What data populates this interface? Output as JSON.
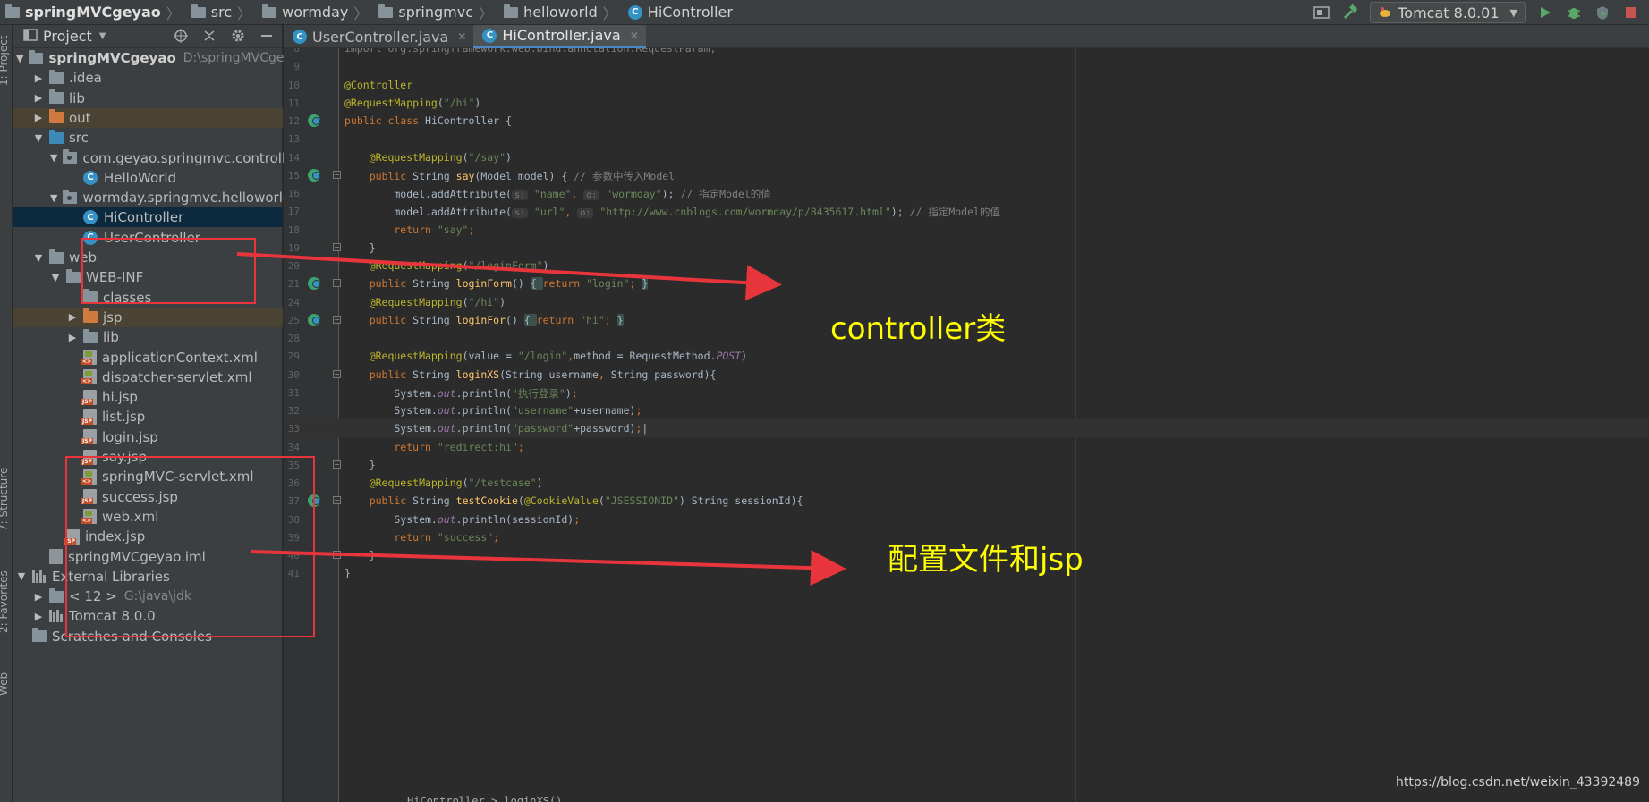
{
  "breadcrumbs": [
    {
      "label": "springMVCgeyao",
      "kind": "folder"
    },
    {
      "label": "src",
      "kind": "folder"
    },
    {
      "label": "wormday",
      "kind": "folder"
    },
    {
      "label": "springmvc",
      "kind": "folder"
    },
    {
      "label": "helloworld",
      "kind": "folder"
    },
    {
      "label": "HiController",
      "kind": "class"
    }
  ],
  "toolbar": {
    "run_config": "Tomcat 8.0.01",
    "icons": [
      "project-structure-icon",
      "build-hammer-icon",
      "run-icon",
      "debug-icon",
      "coverage-icon",
      "stop-icon"
    ]
  },
  "left_stripe": {
    "tabs": [
      "1: Project",
      "7: Structure",
      "2: Favorites",
      "Web"
    ]
  },
  "project_panel": {
    "title": "Project",
    "tree": [
      {
        "label": "springMVCgeyao",
        "extra": "D:\\springMVCgeyao",
        "icon": "module-folder",
        "arrow": "down",
        "depth": 0,
        "bold": true
      },
      {
        "label": ".idea",
        "icon": "folder-grey",
        "arrow": "right",
        "depth": 1
      },
      {
        "label": "lib",
        "icon": "folder-grey",
        "arrow": "right",
        "depth": 1
      },
      {
        "label": "out",
        "icon": "folder-orange",
        "arrow": "right",
        "depth": 1,
        "excluded": true
      },
      {
        "label": "src",
        "icon": "folder-blue",
        "arrow": "down",
        "depth": 1
      },
      {
        "label": "com.geyao.springmvc.controller",
        "icon": "package",
        "arrow": "down",
        "depth": 2
      },
      {
        "label": "HelloWorld",
        "icon": "class",
        "arrow": "",
        "depth": 3
      },
      {
        "label": "wormday.springmvc.helloworld",
        "icon": "package",
        "arrow": "down",
        "depth": 2
      },
      {
        "label": "HiController",
        "icon": "class",
        "arrow": "",
        "depth": 3,
        "selected": true
      },
      {
        "label": "UserController",
        "icon": "class",
        "arrow": "",
        "depth": 3
      },
      {
        "label": "web",
        "icon": "folder-web",
        "arrow": "down",
        "depth": 1
      },
      {
        "label": "WEB-INF",
        "icon": "folder-grey",
        "arrow": "down",
        "depth": 2
      },
      {
        "label": "classes",
        "icon": "folder-grey",
        "arrow": "",
        "depth": 3
      },
      {
        "label": "jsp",
        "icon": "folder-orange",
        "arrow": "right",
        "depth": 3,
        "excluded": true
      },
      {
        "label": "lib",
        "icon": "folder-grey",
        "arrow": "right",
        "depth": 3
      },
      {
        "label": "applicationContext.xml",
        "icon": "xml",
        "arrow": "",
        "depth": 3
      },
      {
        "label": "dispatcher-servlet.xml",
        "icon": "xml",
        "arrow": "",
        "depth": 3
      },
      {
        "label": "hi.jsp",
        "icon": "jsp",
        "arrow": "",
        "depth": 3
      },
      {
        "label": "list.jsp",
        "icon": "jsp",
        "arrow": "",
        "depth": 3
      },
      {
        "label": "login.jsp",
        "icon": "jsp",
        "arrow": "",
        "depth": 3
      },
      {
        "label": "say.jsp",
        "icon": "jsp",
        "arrow": "",
        "depth": 3
      },
      {
        "label": "springMVC-servlet.xml",
        "icon": "xml",
        "arrow": "",
        "depth": 3
      },
      {
        "label": "success.jsp",
        "icon": "jsp",
        "arrow": "",
        "depth": 3
      },
      {
        "label": "web.xml",
        "icon": "xml",
        "arrow": "",
        "depth": 3
      },
      {
        "label": "index.jsp",
        "icon": "jsp",
        "arrow": "",
        "depth": 2
      },
      {
        "label": "springMVCgeyao.iml",
        "icon": "iml",
        "arrow": "",
        "depth": 1
      },
      {
        "label": "External Libraries",
        "icon": "library",
        "arrow": "down",
        "depth": 0
      },
      {
        "label": "< 12 >",
        "extra": "G:\\java\\jdk",
        "icon": "folder-grey",
        "arrow": "right",
        "depth": 1
      },
      {
        "label": "Tomcat 8.0.0",
        "icon": "library",
        "arrow": "right",
        "depth": 1
      },
      {
        "label": "Scratches and Consoles",
        "icon": "scratches",
        "arrow": "",
        "depth": 0
      }
    ]
  },
  "editor": {
    "tabs": [
      {
        "label": "UserController.java",
        "active": false
      },
      {
        "label": "HiController.java",
        "active": true
      }
    ],
    "current_line": 33,
    "lines": [
      {
        "n": 8,
        "tokens": [
          {
            "t": "import org.springframework.web.bind.annotation.RequestParam;",
            "c": "cm"
          }
        ]
      },
      {
        "n": 9,
        "tokens": []
      },
      {
        "n": 10,
        "tokens": [
          {
            "t": "@Controller",
            "c": "an"
          }
        ]
      },
      {
        "n": 11,
        "tokens": [
          {
            "t": "@RequestMapping",
            "c": "an"
          },
          {
            "t": "(",
            "c": ""
          },
          {
            "t": "\"/hi\"",
            "c": "str"
          },
          {
            "t": ")",
            "c": ""
          }
        ]
      },
      {
        "n": 12,
        "tokens": [
          {
            "t": "public class ",
            "c": "kw"
          },
          {
            "t": "HiController {",
            "c": ""
          }
        ],
        "gutter": true
      },
      {
        "n": 13,
        "tokens": []
      },
      {
        "n": 14,
        "tokens": [
          {
            "t": "    @RequestMapping",
            "c": "an"
          },
          {
            "t": "(",
            "c": ""
          },
          {
            "t": "\"/say\"",
            "c": "str"
          },
          {
            "t": ")",
            "c": ""
          }
        ]
      },
      {
        "n": 15,
        "tokens": [
          {
            "t": "    public ",
            "c": "kw"
          },
          {
            "t": "String ",
            "c": ""
          },
          {
            "t": "say",
            "c": "fn"
          },
          {
            "t": "(Model model) { ",
            "c": ""
          },
          {
            "t": "// 参数中传入Model",
            "c": "cm"
          }
        ],
        "gutter": true,
        "fold": true
      },
      {
        "n": 16,
        "tokens": [
          {
            "t": "        model.addAttribute(",
            "c": ""
          },
          {
            "t": "s:",
            "c": "hint"
          },
          {
            "t": " \"name\"",
            "c": "str"
          },
          {
            "t": ", ",
            "c": "kw"
          },
          {
            "t": "o:",
            "c": "hint"
          },
          {
            "t": " \"wormday\"",
            "c": "str"
          },
          {
            "t": "); ",
            "c": ""
          },
          {
            "t": "// 指定Model的值",
            "c": "cm"
          }
        ]
      },
      {
        "n": 17,
        "tokens": [
          {
            "t": "        model.addAttribute(",
            "c": ""
          },
          {
            "t": "s:",
            "c": "hint"
          },
          {
            "t": " \"url\"",
            "c": "str"
          },
          {
            "t": ", ",
            "c": "kw"
          },
          {
            "t": "o:",
            "c": "hint"
          },
          {
            "t": " \"http://www.cnblogs.com/wormday/p/8435617.html\"",
            "c": "str"
          },
          {
            "t": "); ",
            "c": ""
          },
          {
            "t": "// 指定Model的值",
            "c": "cm"
          }
        ]
      },
      {
        "n": 18,
        "tokens": [
          {
            "t": "        return ",
            "c": "kw"
          },
          {
            "t": "\"say\"",
            "c": "str"
          },
          {
            "t": ";",
            "c": "kw"
          }
        ]
      },
      {
        "n": 19,
        "tokens": [
          {
            "t": "    }",
            "c": ""
          }
        ],
        "fold": true
      },
      {
        "n": 20,
        "tokens": [
          {
            "t": "    @RequestMapping",
            "c": "an"
          },
          {
            "t": "(",
            "c": ""
          },
          {
            "t": "\"/loginForm\"",
            "c": "str"
          },
          {
            "t": ")",
            "c": ""
          }
        ]
      },
      {
        "n": 21,
        "tokens": [
          {
            "t": "    public ",
            "c": "kw"
          },
          {
            "t": "String ",
            "c": ""
          },
          {
            "t": "loginForm",
            "c": "fn"
          },
          {
            "t": "() ",
            "c": ""
          },
          {
            "t": "{ ",
            "c": "fold"
          },
          {
            "t": "return ",
            "c": "kw"
          },
          {
            "t": "\"login\"",
            "c": "str"
          },
          {
            "t": "; ",
            "c": "kw"
          },
          {
            "t": "}",
            "c": "fold"
          }
        ],
        "gutter": true,
        "fold": true
      },
      {
        "n": 24,
        "tokens": [
          {
            "t": "    @RequestMapping",
            "c": "an"
          },
          {
            "t": "(",
            "c": ""
          },
          {
            "t": "\"/hi\"",
            "c": "str"
          },
          {
            "t": ")",
            "c": ""
          }
        ]
      },
      {
        "n": 25,
        "tokens": [
          {
            "t": "    public ",
            "c": "kw"
          },
          {
            "t": "String ",
            "c": ""
          },
          {
            "t": "loginFor",
            "c": "fn"
          },
          {
            "t": "() ",
            "c": ""
          },
          {
            "t": "{ ",
            "c": "fold"
          },
          {
            "t": "return ",
            "c": "kw"
          },
          {
            "t": "\"hi\"",
            "c": "str"
          },
          {
            "t": "; ",
            "c": "kw"
          },
          {
            "t": "}",
            "c": "fold"
          }
        ],
        "gutter": true,
        "fold": true
      },
      {
        "n": 28,
        "tokens": []
      },
      {
        "n": 29,
        "tokens": [
          {
            "t": "    @RequestMapping",
            "c": "an"
          },
          {
            "t": "(value = ",
            "c": ""
          },
          {
            "t": "\"/login\"",
            "c": "str"
          },
          {
            "t": ",",
            "c": "kw"
          },
          {
            "t": "method = RequestMethod.",
            "c": ""
          },
          {
            "t": "POST",
            "c": "fld"
          },
          {
            "t": ")",
            "c": ""
          }
        ]
      },
      {
        "n": 30,
        "tokens": [
          {
            "t": "    public ",
            "c": "kw"
          },
          {
            "t": "String ",
            "c": ""
          },
          {
            "t": "loginXS",
            "c": "fn"
          },
          {
            "t": "(String username",
            "c": ""
          },
          {
            "t": ", ",
            "c": "kw"
          },
          {
            "t": "String password){",
            "c": ""
          }
        ],
        "fold": true
      },
      {
        "n": 31,
        "tokens": [
          {
            "t": "        System.",
            "c": ""
          },
          {
            "t": "out",
            "c": "fld"
          },
          {
            "t": ".println(",
            "c": ""
          },
          {
            "t": "\"执行登录\"",
            "c": "str"
          },
          {
            "t": ")",
            "c": ""
          },
          {
            "t": ";",
            "c": "kw"
          }
        ]
      },
      {
        "n": 32,
        "tokens": [
          {
            "t": "        System.",
            "c": ""
          },
          {
            "t": "out",
            "c": "fld"
          },
          {
            "t": ".println(",
            "c": ""
          },
          {
            "t": "\"username\"",
            "c": "str"
          },
          {
            "t": "+username)",
            "c": ""
          },
          {
            "t": ";",
            "c": "kw"
          }
        ]
      },
      {
        "n": 33,
        "tokens": [
          {
            "t": "        System.",
            "c": ""
          },
          {
            "t": "out",
            "c": "fld"
          },
          {
            "t": ".println(",
            "c": ""
          },
          {
            "t": "\"password\"",
            "c": "str"
          },
          {
            "t": "+password)",
            "c": ""
          },
          {
            "t": ";",
            "c": "kw"
          },
          {
            "t": "|",
            "c": ""
          }
        ]
      },
      {
        "n": 34,
        "tokens": [
          {
            "t": "        return ",
            "c": "kw"
          },
          {
            "t": "\"redirect:hi\"",
            "c": "str"
          },
          {
            "t": ";",
            "c": "kw"
          }
        ]
      },
      {
        "n": 35,
        "tokens": [
          {
            "t": "    }",
            "c": ""
          }
        ],
        "fold": true
      },
      {
        "n": 36,
        "tokens": [
          {
            "t": "    @RequestMapping",
            "c": "an"
          },
          {
            "t": "(",
            "c": ""
          },
          {
            "t": "\"/testcase\"",
            "c": "str"
          },
          {
            "t": ")",
            "c": ""
          }
        ]
      },
      {
        "n": 37,
        "tokens": [
          {
            "t": "    public ",
            "c": "kw"
          },
          {
            "t": "String ",
            "c": ""
          },
          {
            "t": "testCookie",
            "c": "fn"
          },
          {
            "t": "(",
            "c": ""
          },
          {
            "t": "@CookieValue",
            "c": "an"
          },
          {
            "t": "(",
            "c": ""
          },
          {
            "t": "\"JSESSIONID\"",
            "c": "str"
          },
          {
            "t": ") String sessionId){",
            "c": ""
          }
        ],
        "gutter": true,
        "fold": true
      },
      {
        "n": 38,
        "tokens": [
          {
            "t": "        System.",
            "c": ""
          },
          {
            "t": "out",
            "c": "fld"
          },
          {
            "t": ".println(sessionId)",
            "c": ""
          },
          {
            "t": ";",
            "c": "kw"
          }
        ]
      },
      {
        "n": 39,
        "tokens": [
          {
            "t": "        return ",
            "c": "kw"
          },
          {
            "t": "\"success\"",
            "c": "str"
          },
          {
            "t": ";",
            "c": "kw"
          }
        ]
      },
      {
        "n": 40,
        "tokens": [
          {
            "t": "    }",
            "c": ""
          }
        ],
        "fold": true
      },
      {
        "n": 41,
        "tokens": [
          {
            "t": "}",
            "c": ""
          }
        ]
      }
    ]
  },
  "annotations": {
    "controller_label": "controller类",
    "config_label": "配置文件和jsp",
    "box_color": "#e8353c",
    "label_color": "#ffff00"
  },
  "bottom_hint": "HiController > loginXS()",
  "watermark": "https://blog.csdn.net/weixin_43392489",
  "colors": {
    "keyword": "#cc7832",
    "annotation": "#bbb529",
    "string": "#6a8759",
    "comment": "#808080",
    "method": "#ffc66d",
    "field": "#9876aa"
  }
}
